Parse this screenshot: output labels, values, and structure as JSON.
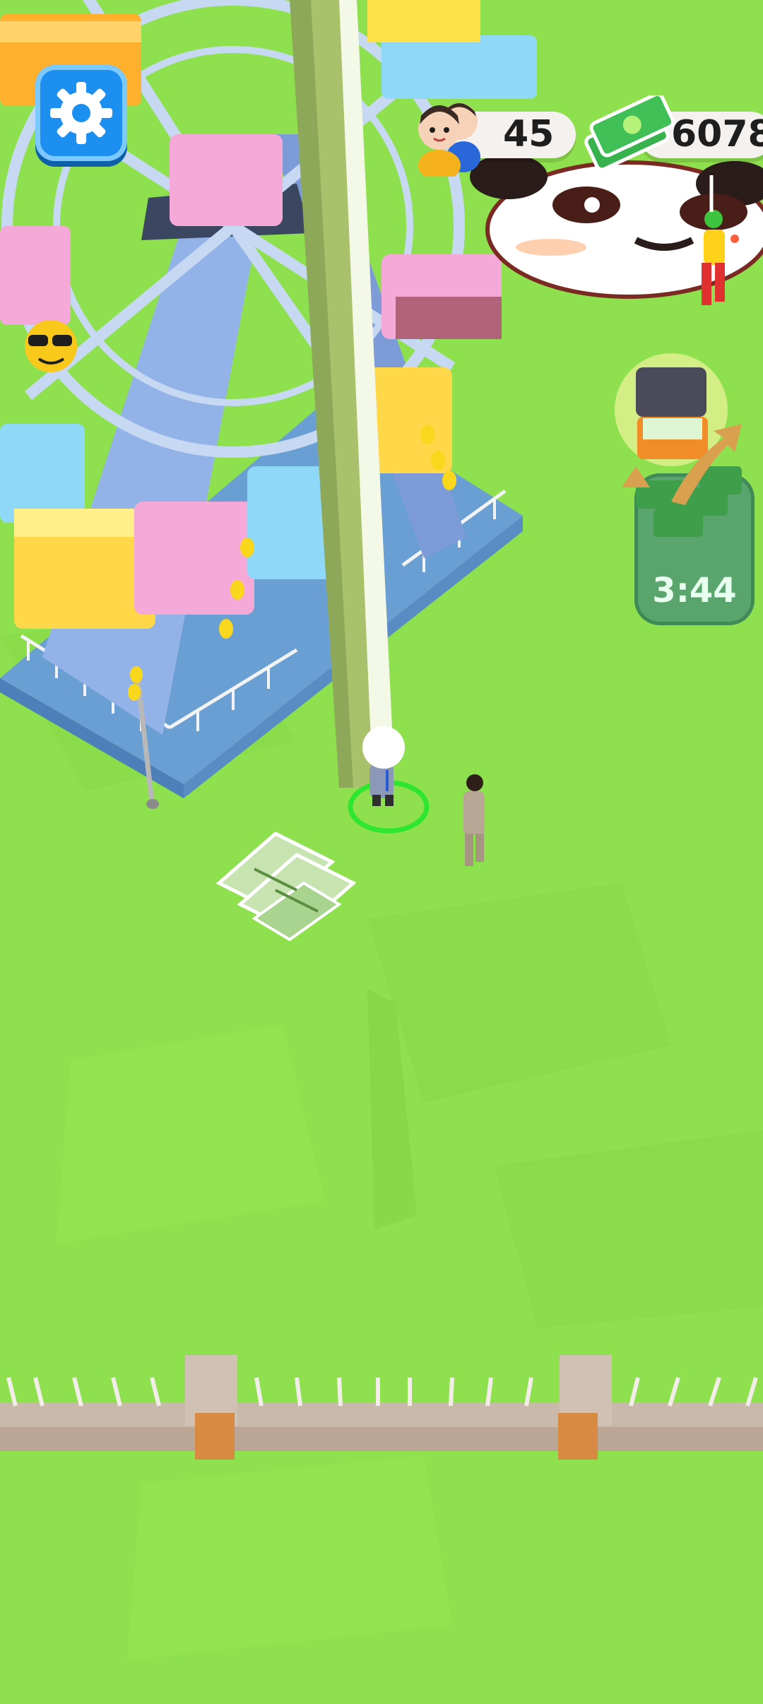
{
  "hud": {
    "visitors_count": "45",
    "cash_amount": "6078",
    "settings_icon": "gear-icon",
    "visitors_icon": "people-icon",
    "cash_icon": "cash-icon"
  },
  "bonus": {
    "timer": "3:44",
    "icon": "treasure-chest-icon"
  },
  "colors": {
    "grass": "#8fe04e",
    "accent_blue": "#1c8ff0",
    "pill": "#f4f1ee",
    "timer_panel": "#5aa56e"
  }
}
